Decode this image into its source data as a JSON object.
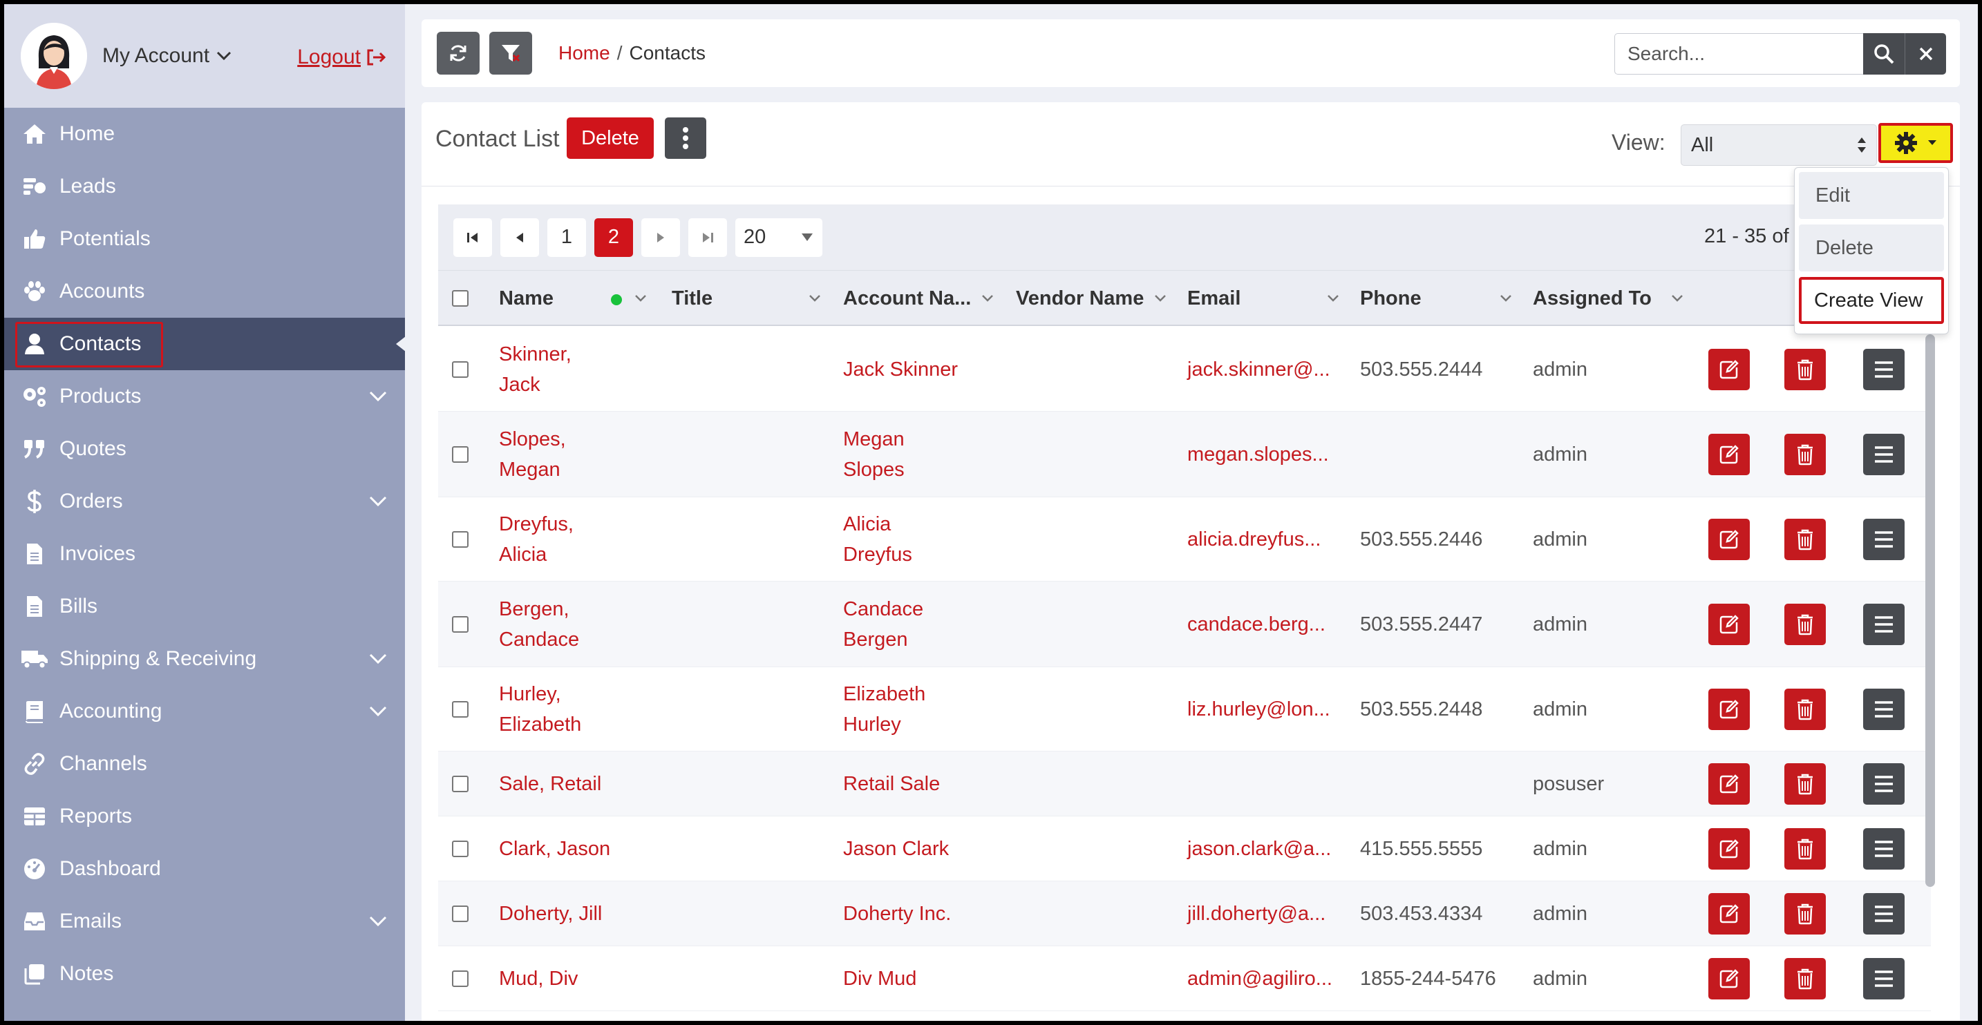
{
  "account": {
    "name": "My Account",
    "logout": "Logout"
  },
  "sidebar": {
    "items": [
      {
        "label": "Home",
        "icon": "home-icon"
      },
      {
        "label": "Leads",
        "icon": "leads-icon"
      },
      {
        "label": "Potentials",
        "icon": "thumbs-up-icon"
      },
      {
        "label": "Accounts",
        "icon": "paw-icon"
      },
      {
        "label": "Contacts",
        "icon": "user-icon",
        "active": true
      },
      {
        "label": "Products",
        "icon": "cogs-icon",
        "expandable": true
      },
      {
        "label": "Quotes",
        "icon": "quote-icon"
      },
      {
        "label": "Orders",
        "icon": "dollar-icon",
        "expandable": true
      },
      {
        "label": "Invoices",
        "icon": "file-icon"
      },
      {
        "label": "Bills",
        "icon": "file-icon"
      },
      {
        "label": "Shipping & Receiving",
        "icon": "truck-icon",
        "expandable": true
      },
      {
        "label": "Accounting",
        "icon": "book-icon",
        "expandable": true
      },
      {
        "label": "Channels",
        "icon": "link-icon"
      },
      {
        "label": "Reports",
        "icon": "table-icon"
      },
      {
        "label": "Dashboard",
        "icon": "gauge-icon"
      },
      {
        "label": "Emails",
        "icon": "inbox-icon",
        "expandable": true
      },
      {
        "label": "Notes",
        "icon": "notes-icon"
      }
    ]
  },
  "topbar": {
    "breadcrumb_home": "Home",
    "breadcrumb_sep": "/",
    "breadcrumb_current": "Contacts",
    "search_placeholder": "Search..."
  },
  "panel": {
    "title": "Contact List",
    "delete_label": "Delete",
    "view_label": "View:",
    "view_value": "All"
  },
  "dropdown": {
    "edit": "Edit",
    "delete": "Delete",
    "create_view": "Create View"
  },
  "pager": {
    "page1": "1",
    "page2": "2",
    "page_size": "20",
    "count": "21 - 35 of"
  },
  "table": {
    "columns": [
      "Name",
      "Title",
      "Account Na...",
      "Vendor Name",
      "Email",
      "Phone",
      "Assigned To"
    ],
    "rows": [
      {
        "name1": "Skinner,",
        "name2": "Jack",
        "acct1": "Jack Skinner",
        "acct2": "",
        "email": "jack.skinner@...",
        "phone": "503.555.2444",
        "assigned": "admin"
      },
      {
        "name1": "Slopes,",
        "name2": "Megan",
        "acct1": "Megan",
        "acct2": "Slopes",
        "email": "megan.slopes...",
        "phone": "",
        "assigned": "admin"
      },
      {
        "name1": "Dreyfus,",
        "name2": "Alicia",
        "acct1": "Alicia",
        "acct2": "Dreyfus",
        "email": "alicia.dreyfus...",
        "phone": "503.555.2446",
        "assigned": "admin"
      },
      {
        "name1": "Bergen,",
        "name2": "Candace",
        "acct1": "Candace",
        "acct2": "Bergen",
        "email": "candace.berg...",
        "phone": "503.555.2447",
        "assigned": "admin"
      },
      {
        "name1": "Hurley,",
        "name2": "Elizabeth",
        "acct1": "Elizabeth",
        "acct2": "Hurley",
        "email": "liz.hurley@lon...",
        "phone": "503.555.2448",
        "assigned": "admin"
      },
      {
        "name1": "Sale, Retail",
        "name2": "",
        "acct1": "Retail Sale",
        "acct2": "",
        "email": "",
        "phone": "",
        "assigned": "posuser"
      },
      {
        "name1": "Clark, Jason",
        "name2": "",
        "acct1": "Jason Clark",
        "acct2": "",
        "email": "jason.clark@a...",
        "phone": "415.555.5555",
        "assigned": "admin"
      },
      {
        "name1": "Doherty, Jill",
        "name2": "",
        "acct1": "Doherty Inc.",
        "acct2": "",
        "email": "jill.doherty@a...",
        "phone": "503.453.4334",
        "assigned": "admin"
      },
      {
        "name1": "Mud, Div",
        "name2": "",
        "acct1": "Div Mud",
        "acct2": "",
        "email": "admin@agiliro...",
        "phone": "1855-244-5476",
        "assigned": "admin"
      }
    ]
  },
  "colors": {
    "accent": "#d0141b",
    "sidebar": "#97a0bd",
    "sidebar_active": "#454e6b",
    "highlight": "#f5ea14"
  }
}
